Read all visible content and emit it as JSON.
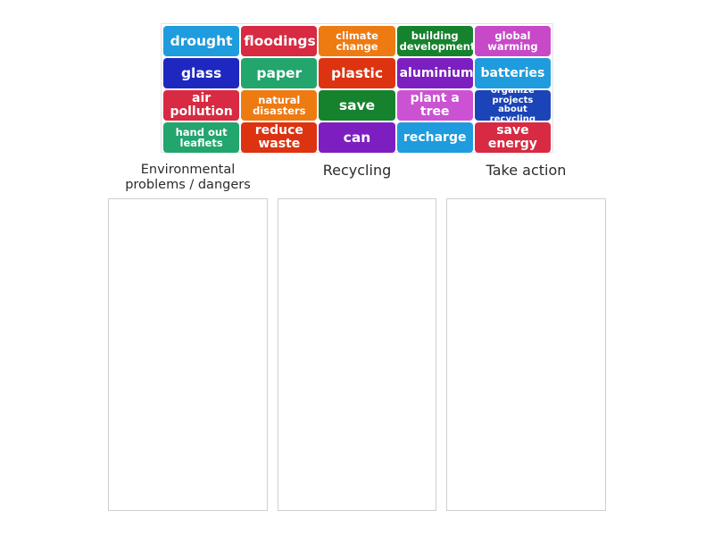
{
  "activity": {
    "type": "group-sort",
    "tile_bank": {
      "name": "word-tile-bank",
      "rows": [
        [
          {
            "label": "drought",
            "color": "#1f9cdd",
            "size": "lg"
          },
          {
            "label": "floodings",
            "color": "#d82a42",
            "size": "lg"
          },
          {
            "label": "climate\nchange",
            "color": "#ee7b12",
            "size": "sm"
          },
          {
            "label": "building\ndevelopment",
            "color": "#17822e",
            "size": "sm"
          },
          {
            "label": "global\nwarming",
            "color": "#c849c8",
            "size": "sm"
          }
        ],
        [
          {
            "label": "glass",
            "color": "#1e28c0",
            "size": "lg"
          },
          {
            "label": "paper",
            "color": "#23a56e",
            "size": "lg"
          },
          {
            "label": "plastic",
            "color": "#dd3311",
            "size": "lg"
          },
          {
            "label": "aluminium",
            "color": "#7d1fc0",
            "size": "md"
          },
          {
            "label": "batteries",
            "color": "#1f9cdd",
            "size": "md"
          }
        ],
        [
          {
            "label": "air pollution",
            "color": "#d82a42",
            "size": "md"
          },
          {
            "label": "natural\ndisasters",
            "color": "#ee7b12",
            "size": "sm"
          },
          {
            "label": "save",
            "color": "#17822e",
            "size": "lg"
          },
          {
            "label": "plant a tree",
            "color": "#cc52d4",
            "size": "md"
          },
          {
            "label": "organize projects\nabout recycling",
            "color": "#1a44b8",
            "size": "xs"
          }
        ],
        [
          {
            "label": "hand out\nleaflets",
            "color": "#23a56e",
            "size": "sm"
          },
          {
            "label": "reduce waste",
            "color": "#dd3311",
            "size": "md"
          },
          {
            "label": "can",
            "color": "#7d1fc0",
            "size": "lg"
          },
          {
            "label": "recharge",
            "color": "#1f9cdd",
            "size": "md"
          },
          {
            "label": "save energy",
            "color": "#d82a42",
            "size": "md"
          }
        ]
      ]
    },
    "columns": [
      {
        "title": "Environmental\nproblems / dangers",
        "lines": 2,
        "items": []
      },
      {
        "title": "Recycling",
        "lines": 1,
        "items": []
      },
      {
        "title": "Take action",
        "lines": 1,
        "items": []
      }
    ]
  }
}
